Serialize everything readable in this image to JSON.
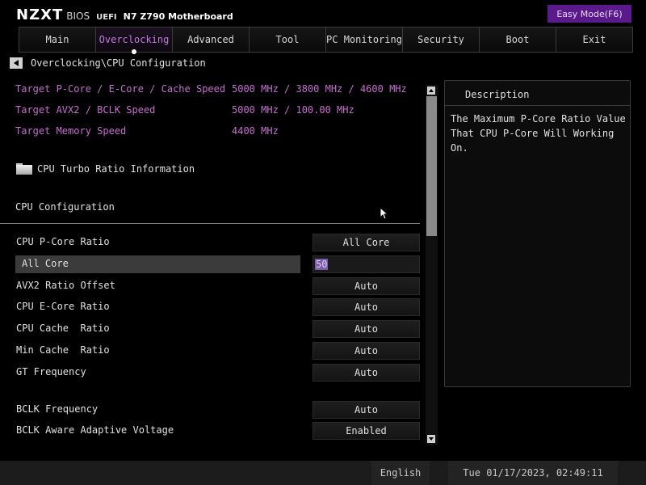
{
  "header": {
    "brand": "NZXT",
    "bios": "BIOS",
    "uefi": "UEFI",
    "model": "N7 Z790 Motherboard",
    "easy_mode_button": "Easy Mode(F6)"
  },
  "tabs": [
    {
      "label": "Main",
      "active": false
    },
    {
      "label": "Overclocking",
      "active": true
    },
    {
      "label": "Advanced",
      "active": false
    },
    {
      "label": "Tool",
      "active": false
    },
    {
      "label": "PC Monitoring",
      "active": false
    },
    {
      "label": "Security",
      "active": false
    },
    {
      "label": "Boot",
      "active": false
    },
    {
      "label": "Exit",
      "active": false
    }
  ],
  "breadcrumb": "Overclocking\\CPU Configuration",
  "targets": [
    {
      "label": "Target P-Core / E-Core / Cache Speed",
      "value": "5000 MHz / 3800 MHz / 4600 MHz"
    },
    {
      "label": "Target AVX2 / BCLK Speed",
      "value": "5000 MHz / 100.00 MHz"
    },
    {
      "label": "Target Memory Speed",
      "value": "4400 MHz"
    }
  ],
  "turbo_folder_label": "CPU Turbo Ratio Information",
  "section_title": "CPU Configuration",
  "settings": [
    {
      "label": "CPU P-Core Ratio",
      "value": "All Core"
    },
    {
      "label": "All Core",
      "value": "50",
      "selected": true,
      "input": true
    },
    {
      "label": "AVX2 Ratio Offset",
      "value": "Auto"
    },
    {
      "label": "CPU E-Core Ratio",
      "value": "Auto"
    },
    {
      "label": "CPU Cache  Ratio",
      "value": "Auto"
    },
    {
      "label": "Min Cache  Ratio",
      "value": "Auto"
    },
    {
      "label": "GT Frequency",
      "value": "Auto"
    },
    {
      "label": "BCLK Frequency",
      "value": "Auto"
    },
    {
      "label": "BCLK Aware Adaptive Voltage",
      "value": "Enabled"
    }
  ],
  "description": {
    "title": "Description",
    "text": "The Maximum P-Core Ratio Value That CPU P-Core Will Working On."
  },
  "footer": {
    "language": "English",
    "datetime": "Tue 01/17/2023, 02:49:11"
  },
  "colors": {
    "accent_purple": "#5a1a8c",
    "target_text": "#c56fcf",
    "active_tab": "#c07ae0"
  }
}
